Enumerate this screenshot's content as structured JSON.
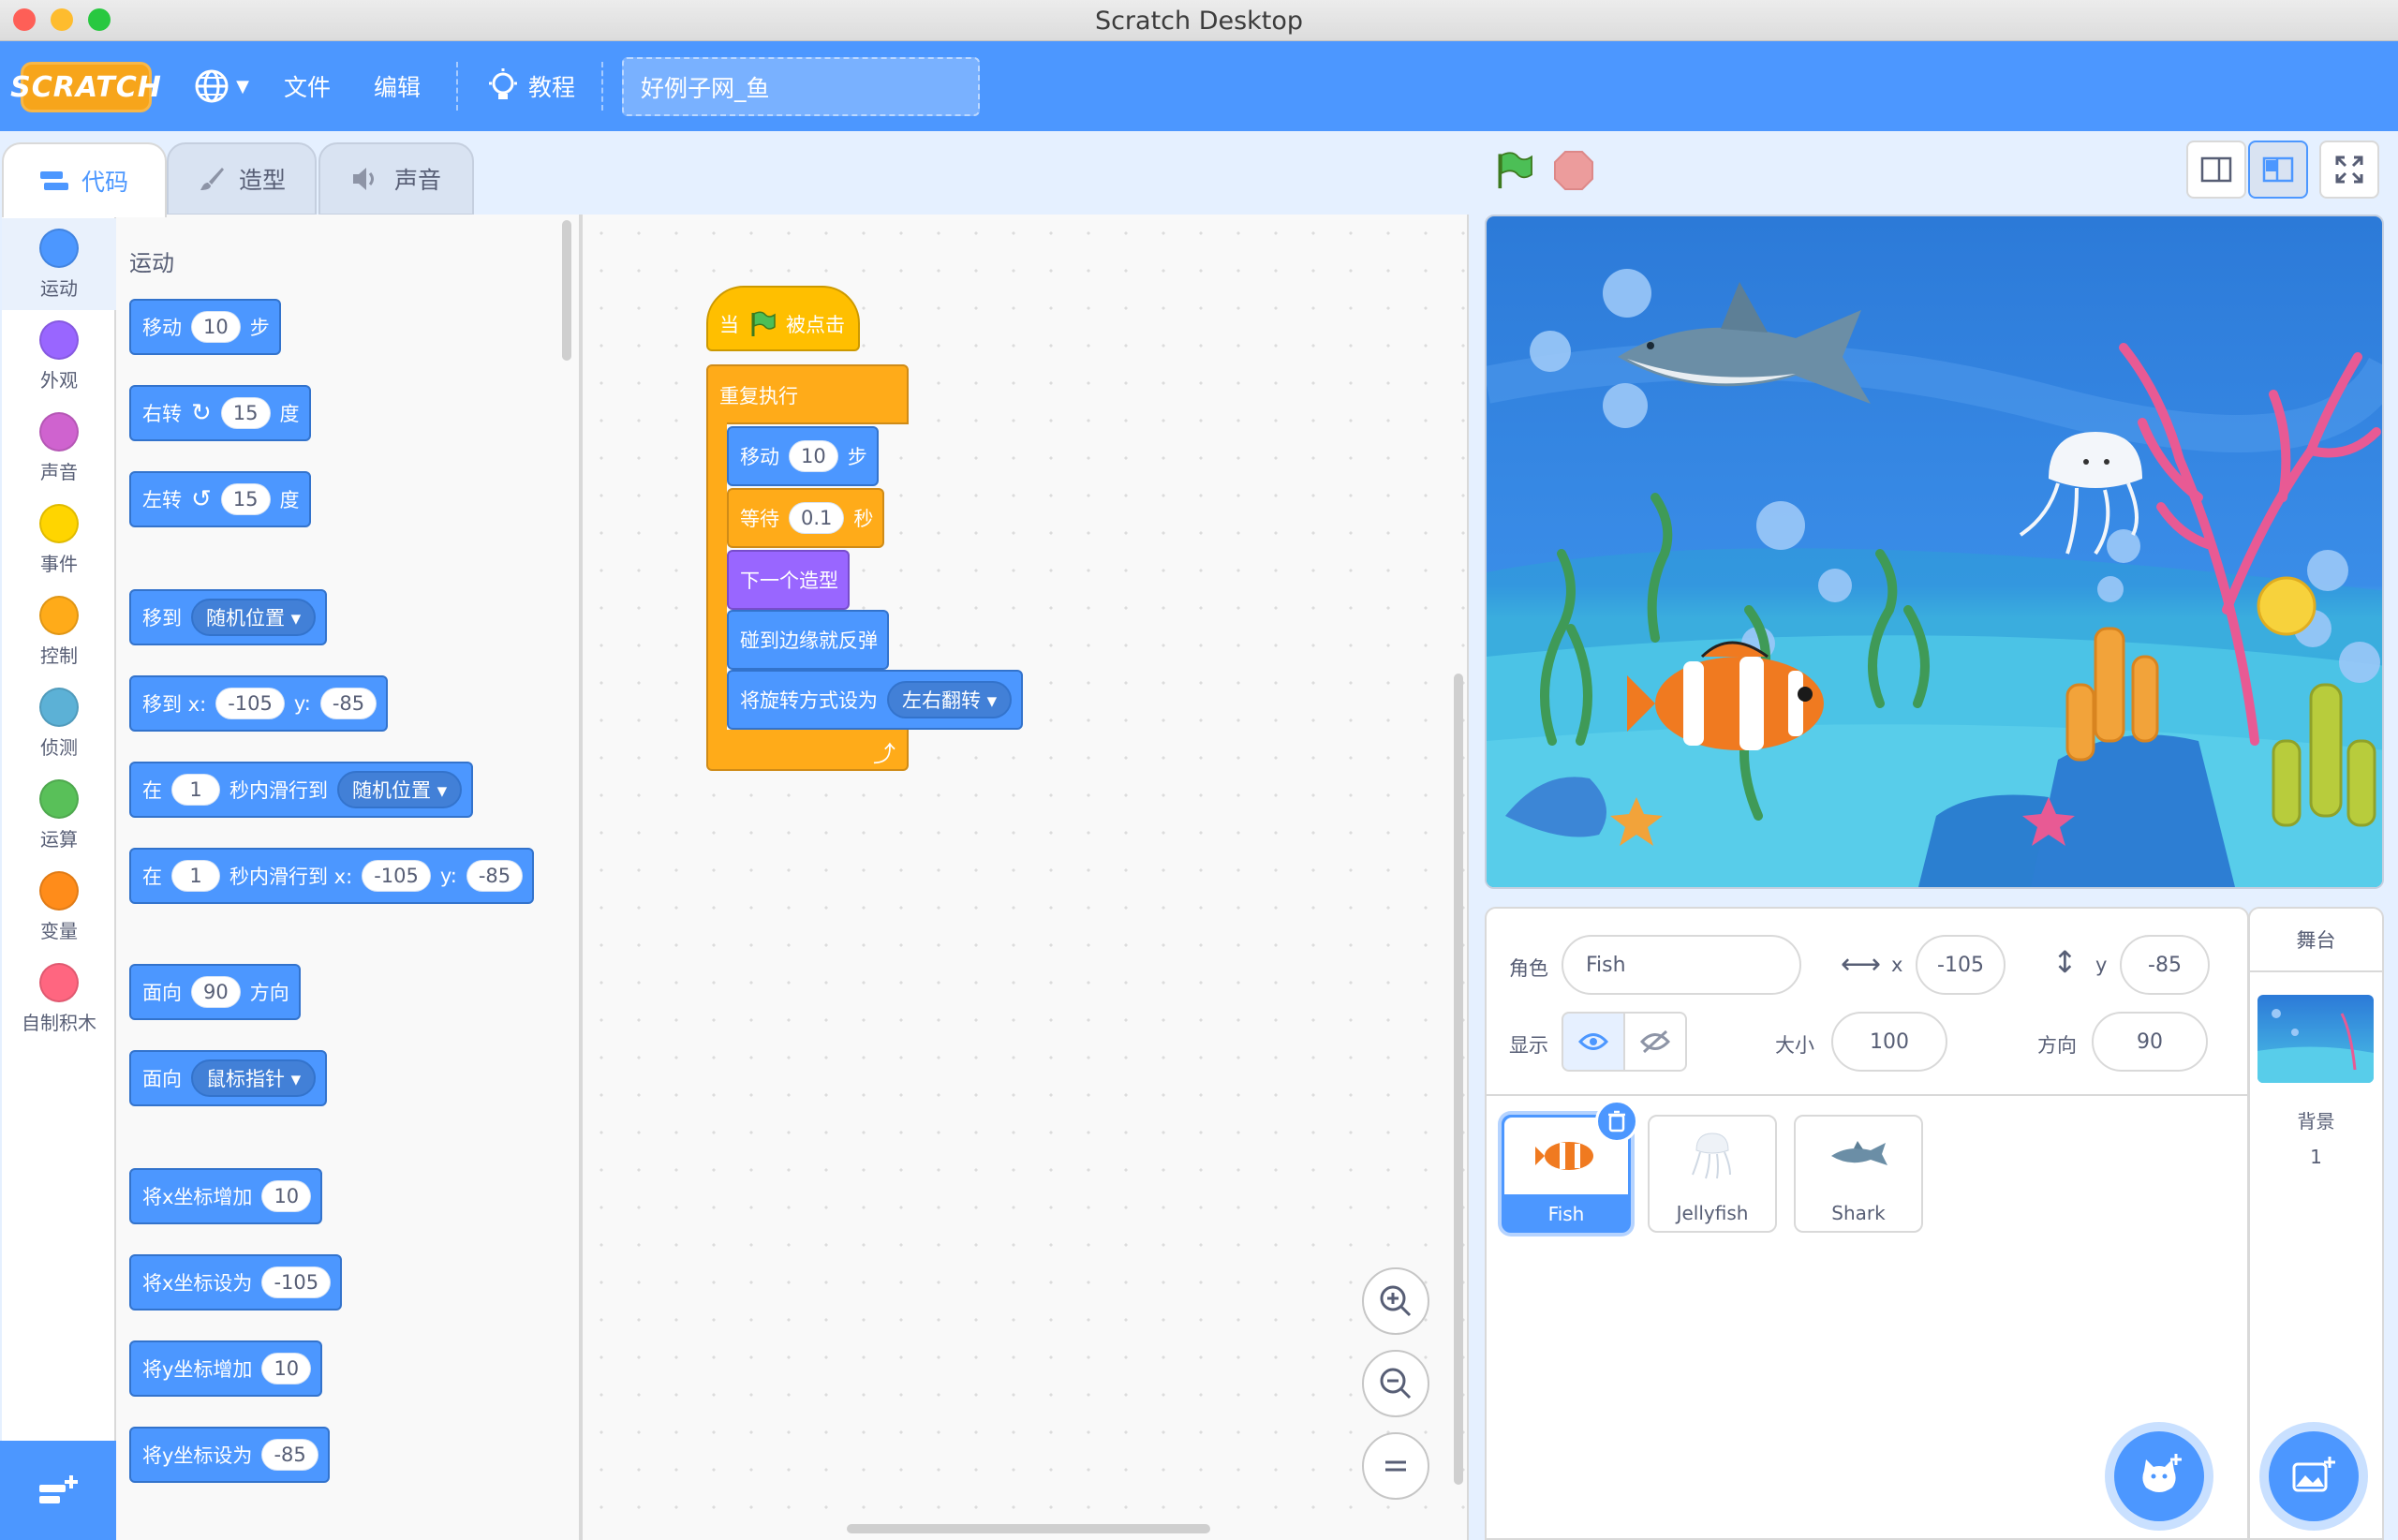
{
  "window": {
    "title": "Scratch Desktop"
  },
  "menu": {
    "logo": "SCRATCH",
    "file": "文件",
    "edit": "编辑",
    "tutorials": "教程",
    "project_title": "好例子网_鱼"
  },
  "tabs": {
    "code": "代码",
    "costumes": "造型",
    "sounds": "声音"
  },
  "categories": [
    {
      "label": "运动",
      "color": "#4c97ff"
    },
    {
      "label": "外观",
      "color": "#9966ff"
    },
    {
      "label": "声音",
      "color": "#cf63cf"
    },
    {
      "label": "事件",
      "color": "#ffd500"
    },
    {
      "label": "控制",
      "color": "#ffab19"
    },
    {
      "label": "侦测",
      "color": "#5cb1d6"
    },
    {
      "label": "运算",
      "color": "#59c059"
    },
    {
      "label": "变量",
      "color": "#ff8c1a"
    },
    {
      "label": "自制积木",
      "color": "#ff6680"
    }
  ],
  "palette": {
    "section_title": "运动",
    "move": {
      "label": "移动",
      "value": "10",
      "suffix": "步"
    },
    "turn_right": {
      "label": "右转",
      "value": "15",
      "suffix": "度"
    },
    "turn_left": {
      "label": "左转",
      "value": "15",
      "suffix": "度"
    },
    "goto": {
      "label": "移到",
      "option": "随机位置"
    },
    "goto_xy": {
      "label": "移到 x:",
      "x": "-105",
      "ylabel": "y:",
      "y": "-85"
    },
    "glide": {
      "pre": "在",
      "secs": "1",
      "mid": "秒内滑行到",
      "option": "随机位置"
    },
    "glide_xy": {
      "pre": "在",
      "secs": "1",
      "mid": "秒内滑行到 x:",
      "x": "-105",
      "ylabel": "y:",
      "y": "-85"
    },
    "point_dir": {
      "label": "面向",
      "value": "90",
      "suffix": "方向"
    },
    "point_towards": {
      "label": "面向",
      "option": "鼠标指针"
    },
    "change_x": {
      "label": "将x坐标增加",
      "value": "10"
    },
    "set_x": {
      "label": "将x坐标设为",
      "value": "-105"
    },
    "change_y": {
      "label": "将y坐标增加",
      "value": "10"
    },
    "set_y": {
      "label": "将y坐标设为",
      "value": "-85"
    }
  },
  "script": {
    "hat_pre": "当",
    "hat_post": "被点击",
    "forever": "重复执行",
    "move": {
      "label": "移动",
      "value": "10",
      "suffix": "步"
    },
    "wait": {
      "label": "等待",
      "value": "0.1",
      "suffix": "秒"
    },
    "next_costume": "下一个造型",
    "bounce": "碰到边缘就反弹",
    "rotation": {
      "label": "将旋转方式设为",
      "option": "左右翻转"
    }
  },
  "sprite_info": {
    "sprite_label": "角色",
    "sprite_name": "Fish",
    "x_label": "x",
    "x": "-105",
    "y_label": "y",
    "y": "-85",
    "show_label": "显示",
    "size_label": "大小",
    "size": "100",
    "direction_label": "方向",
    "direction": "90"
  },
  "sprites": [
    {
      "name": "Fish",
      "selected": true
    },
    {
      "name": "Jellyfish",
      "selected": false
    },
    {
      "name": "Shark",
      "selected": false
    }
  ],
  "stage_panel": {
    "title": "舞台",
    "backdrop_label": "背景",
    "backdrop_count": "1"
  },
  "colors": {
    "motion": "#4c97ff",
    "looks": "#9966ff",
    "control": "#ffab19",
    "events": "#ffbf00",
    "menu": "#4c97ff"
  }
}
